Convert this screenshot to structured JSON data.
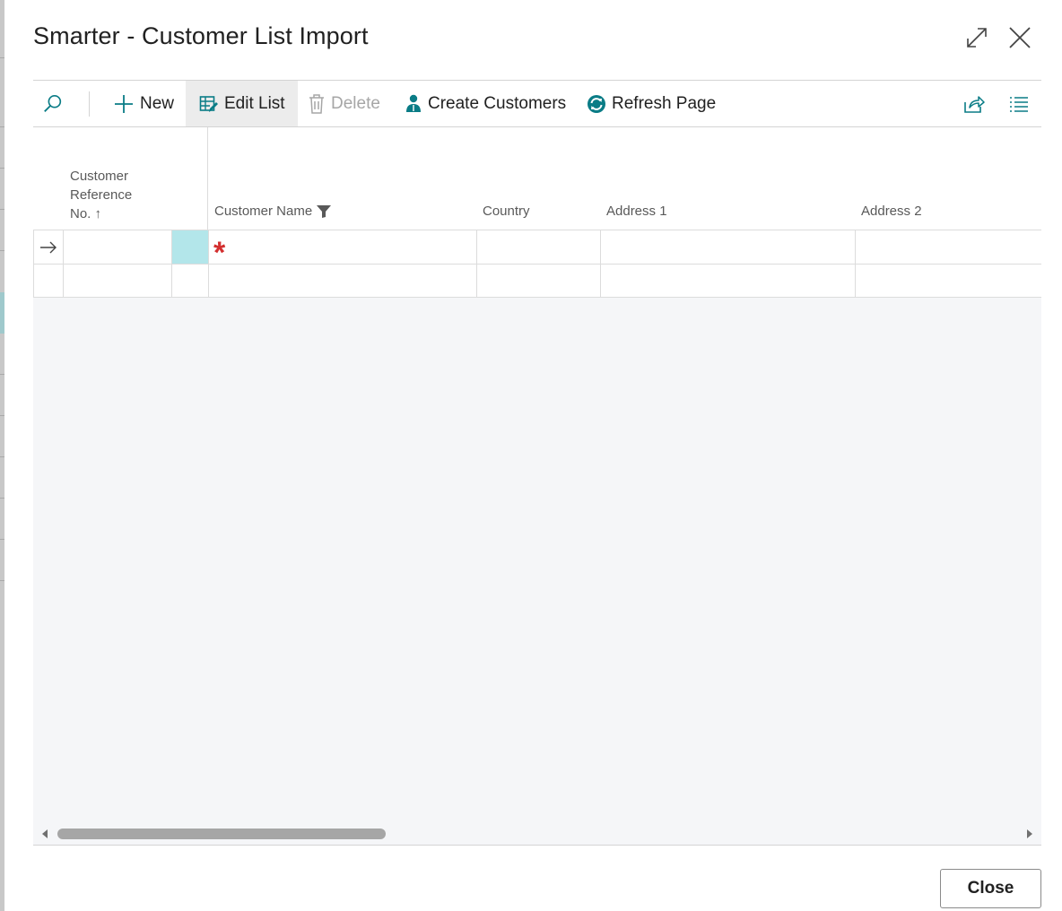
{
  "dialog": {
    "title": "Smarter - Customer List Import",
    "expand_icon": "expand-icon",
    "close_icon": "close-icon"
  },
  "toolbar": {
    "search_icon": "search-icon",
    "new_label": "New",
    "edit_list_label": "Edit List",
    "delete_label": "Delete",
    "create_customers_label": "Create Customers",
    "refresh_page_label": "Refresh Page",
    "share_icon": "share-icon",
    "list_view_icon": "list-view-icon"
  },
  "grid": {
    "columns": [
      {
        "line1": "Customer",
        "line2": "Reference",
        "line3": "No. ↑"
      },
      {
        "label": "Customer Name"
      },
      {
        "label": "Country"
      },
      {
        "label": "Address 1"
      },
      {
        "label": "Address 2"
      }
    ],
    "sort_icon": "arrow-up-icon",
    "filter_icon": "funnel-icon",
    "required_marker": "*",
    "row_indicator_icon": "arrow-right-icon"
  },
  "footer": {
    "close_label": "Close"
  },
  "colors": {
    "accent": "#0a7c86",
    "selected_cell": "#b3e6ea",
    "required": "#d32f2f",
    "empty_area": "#f5f6f8"
  }
}
